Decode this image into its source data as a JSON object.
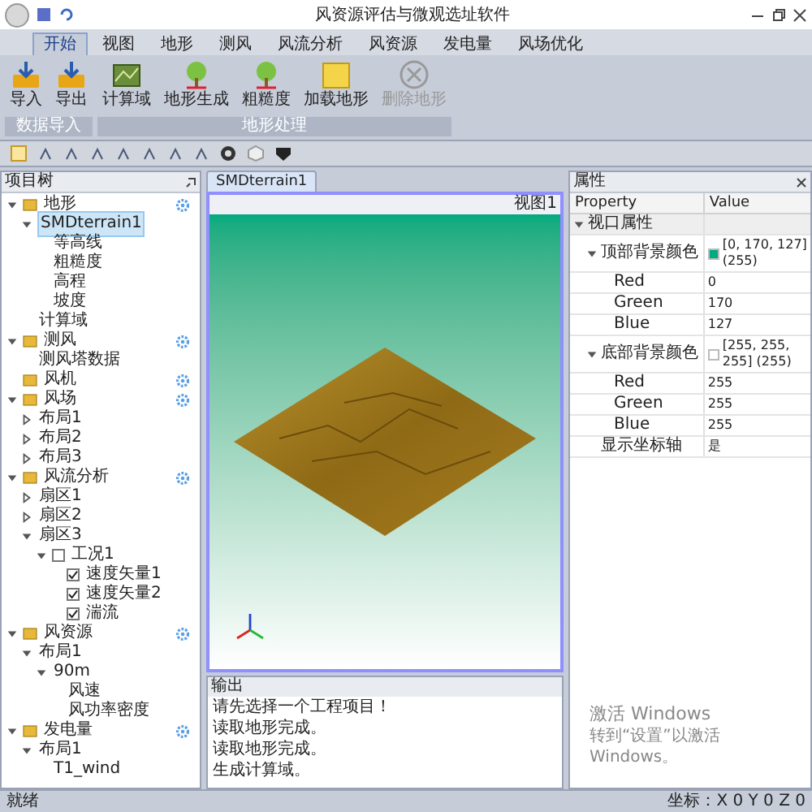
{
  "window": {
    "title": "风资源评估与微观选址软件"
  },
  "ribbon_tabs": [
    {
      "label": "开始",
      "selected": true
    },
    {
      "label": "视图",
      "selected": false
    },
    {
      "label": "地形",
      "selected": false
    },
    {
      "label": "测风",
      "selected": false
    },
    {
      "label": "风流分析",
      "selected": false
    },
    {
      "label": "风资源",
      "selected": false
    },
    {
      "label": "发电量",
      "selected": false
    },
    {
      "label": "风场优化",
      "selected": false
    }
  ],
  "ribbon_groups": [
    {
      "label": "数据导入",
      "buttons": [
        {
          "label": "导入",
          "disabled": false
        },
        {
          "label": "导出",
          "disabled": false
        }
      ]
    },
    {
      "label": "地形处理",
      "buttons": [
        {
          "label": "计算域",
          "disabled": false
        },
        {
          "label": "地形生成",
          "disabled": false
        },
        {
          "label": "粗糙度",
          "disabled": false
        },
        {
          "label": "加载地形",
          "disabled": false
        },
        {
          "label": "删除地形",
          "disabled": true
        }
      ]
    }
  ],
  "tree_panel": {
    "title": "项目树",
    "items": [
      {
        "label": "地形",
        "expanded": true,
        "children": [
          {
            "label": "SMDterrain1",
            "expanded": true,
            "selected": true,
            "children": [
              {
                "label": "等高线"
              },
              {
                "label": "粗糙度"
              },
              {
                "label": "高程"
              },
              {
                "label": "坡度"
              }
            ]
          },
          {
            "label": "计算域"
          }
        ]
      },
      {
        "label": "测风",
        "expanded": true,
        "children": [
          {
            "label": "测风塔数据"
          }
        ]
      },
      {
        "label": "风机"
      },
      {
        "label": "风场",
        "expanded": true,
        "children": [
          {
            "label": "布局1",
            "expanded": false
          },
          {
            "label": "布局2",
            "expanded": false
          },
          {
            "label": "布局3",
            "expanded": false
          }
        ]
      },
      {
        "label": "风流分析",
        "expanded": true,
        "children": [
          {
            "label": "扇区1",
            "expanded": false
          },
          {
            "label": "扇区2",
            "expanded": false
          },
          {
            "label": "扇区3",
            "expanded": true,
            "children": [
              {
                "label": "工况1",
                "expanded": true,
                "checked": false,
                "children": [
                  {
                    "label": "速度矢量1",
                    "checked": true
                  },
                  {
                    "label": "速度矢量2",
                    "checked": true
                  },
                  {
                    "label": "湍流",
                    "checked": true
                  }
                ]
              }
            ]
          }
        ]
      },
      {
        "label": "风资源",
        "expanded": true,
        "children": [
          {
            "label": "布局1",
            "expanded": true,
            "children": [
              {
                "label": "90m",
                "expanded": true,
                "children": [
                  {
                    "label": "风速"
                  },
                  {
                    "label": "风功率密度"
                  }
                ]
              }
            ]
          }
        ]
      },
      {
        "label": "发电量",
        "expanded": true,
        "children": [
          {
            "label": "布局1",
            "expanded": true,
            "children": [
              {
                "label": "T1_wind"
              }
            ]
          }
        ]
      }
    ]
  },
  "document_tab": {
    "label": "SMDterrain1"
  },
  "viewport": {
    "title": "视图1"
  },
  "output": {
    "title": "输出",
    "lines": [
      "请先选择一个工程项目！",
      "读取地形完成。",
      "读取地形完成。",
      "生成计算域。"
    ]
  },
  "properties": {
    "title": "属性",
    "columns": [
      "Property",
      "Value"
    ],
    "rows": [
      {
        "name": "视口属性",
        "expanded": true,
        "children": [
          {
            "name": "顶部背景颜色",
            "value": "[0, 170, 127] (255)",
            "color": "#00aa7f",
            "expanded": true,
            "children": [
              {
                "name": "Red",
                "value": "0"
              },
              {
                "name": "Green",
                "value": "170"
              },
              {
                "name": "Blue",
                "value": "127"
              }
            ]
          },
          {
            "name": "底部背景颜色",
            "value": "[255, 255, 255] (255)",
            "color": "#ffffff",
            "expanded": true,
            "children": [
              {
                "name": "Red",
                "value": "255"
              },
              {
                "name": "Green",
                "value": "255"
              },
              {
                "name": "Blue",
                "value": "255"
              }
            ]
          },
          {
            "name": "显示坐标轴",
            "value": "是"
          }
        ]
      }
    ]
  },
  "watermark_os": {
    "title": "激活 Windows",
    "subtitle": "转到“设置”以激活 Windows。"
  },
  "status_bar": {
    "left": "就绪",
    "right": "坐标：X 0  Y 0  Z 0"
  }
}
